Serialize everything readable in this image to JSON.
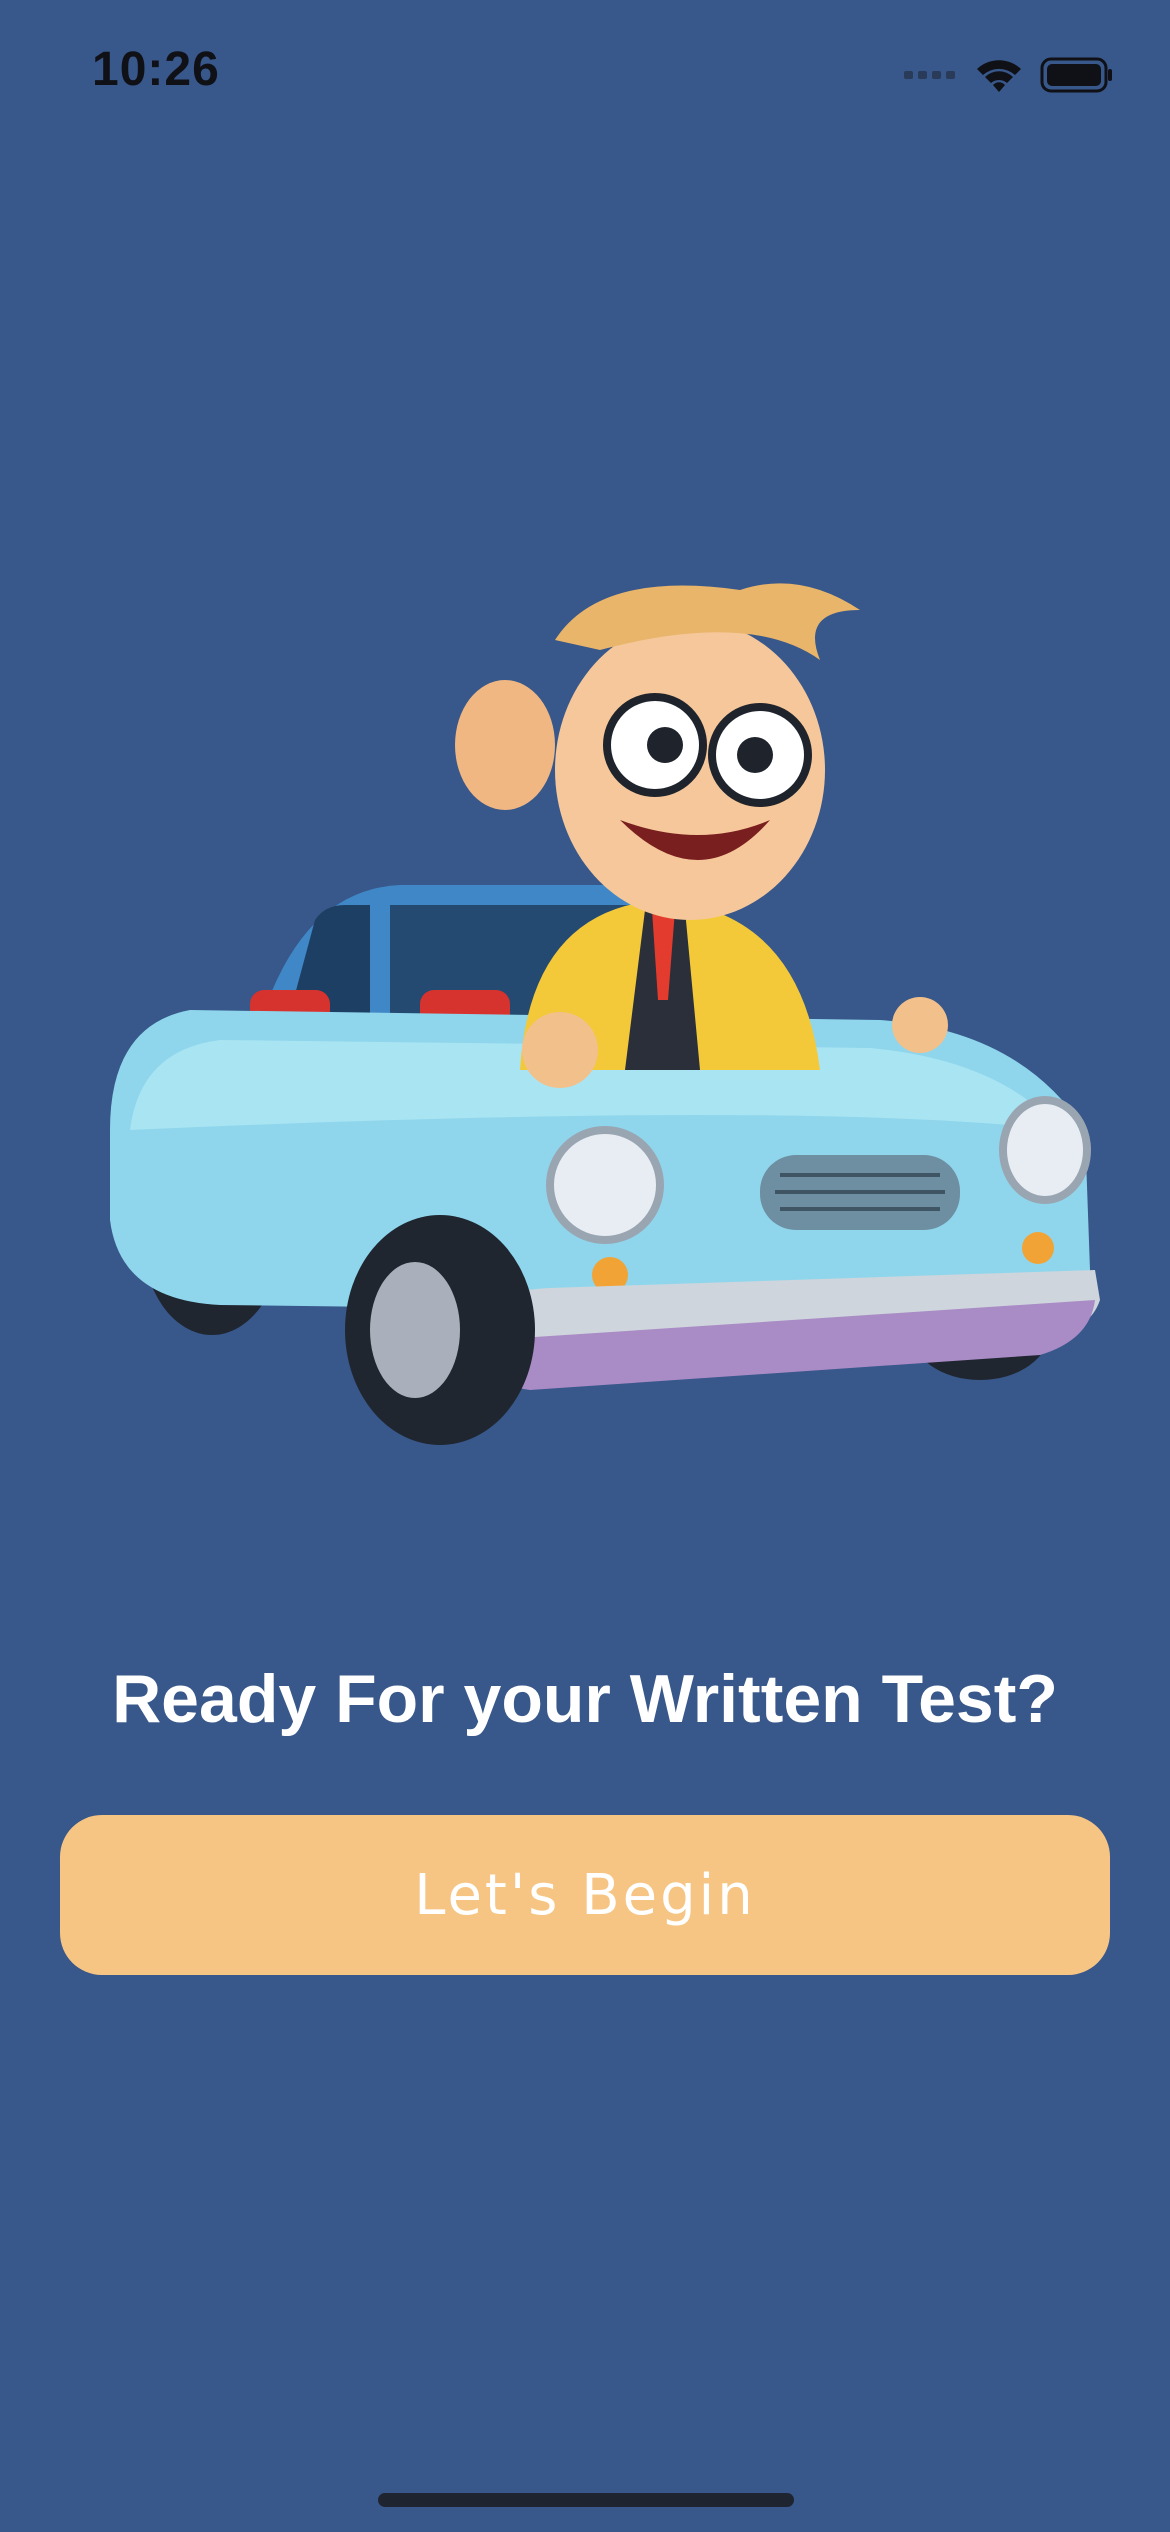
{
  "status_bar": {
    "time": "10:26",
    "icons": [
      "cellular-signal-icon",
      "wifi-icon",
      "battery-icon"
    ]
  },
  "hero": {
    "image": "cartoon-driver-in-blue-car-illustration"
  },
  "main": {
    "headline": "Ready For your Written Test?",
    "begin_button_label": "Let's Begin"
  },
  "colors": {
    "background": "#38578a",
    "button": "#f7c583",
    "button_text": "#ffffff",
    "headline_text": "#ffffff"
  }
}
